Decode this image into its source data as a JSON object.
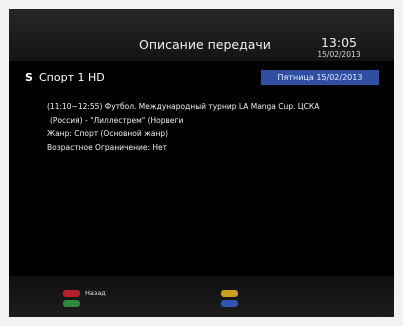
{
  "header": {
    "title": "Описание передачи",
    "time": "13:05",
    "date": "15/02/2013"
  },
  "channel": {
    "marker": "S",
    "name": "Спорт 1 HD",
    "date_badge": "Пятница 15/02/2013"
  },
  "program": {
    "line1": "(11:10~12:55) Футбол. Международный турнир LA Manga Cup. ЦСКА",
    "line2": "(Россия) - \"Лиллестрем\" (Норвеги",
    "genre": "Жанр: Спорт (Основной жанр)",
    "age": "Возрастное Ограничение: Нет"
  },
  "footer": {
    "red_label": "Назад"
  },
  "colors": {
    "date_badge": "#2f4fa3",
    "red_key": "#b8202a",
    "green_key": "#2e8a3a",
    "yellow_key": "#c9a020",
    "blue_key": "#2f56b0"
  }
}
